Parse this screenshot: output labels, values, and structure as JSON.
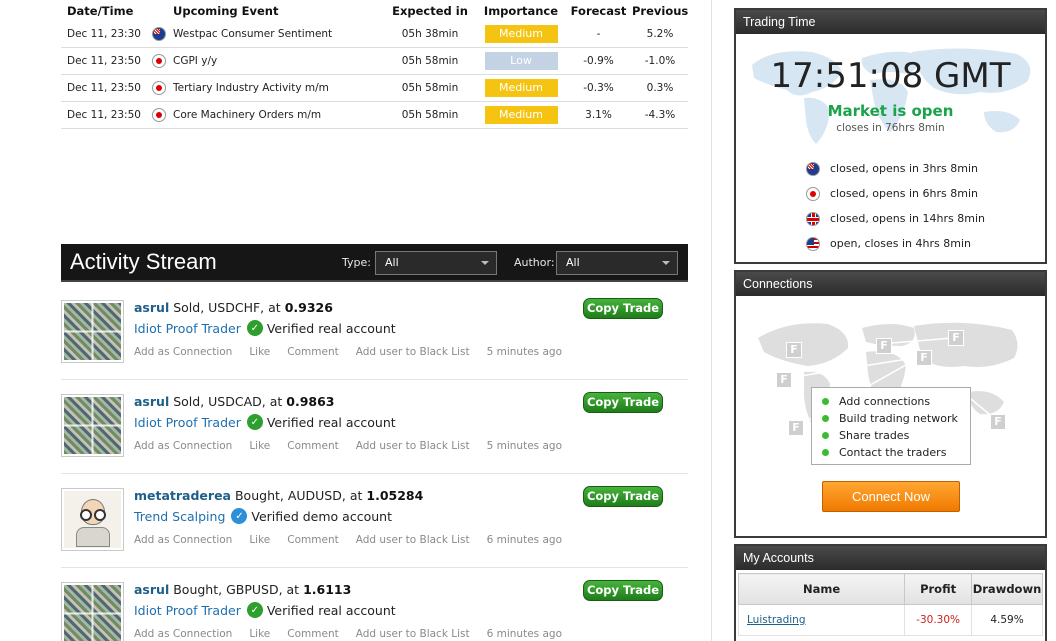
{
  "calendar": {
    "headers": {
      "date": "Date/Time",
      "event": "Upcoming Event",
      "expected": "Expected in",
      "importance": "Importance",
      "forecast": "Forecast",
      "previous": "Previous"
    },
    "rows": [
      {
        "date": "Dec 11, 23:30",
        "flag": "flag-au-icon",
        "event": "Westpac Consumer Sentiment",
        "expected": "05h 38min",
        "importance": "Medium",
        "forecast": "-",
        "previous": "5.2%"
      },
      {
        "date": "Dec 11, 23:50",
        "flag": "flag-jp-icon",
        "event": "CGPI y/y",
        "expected": "05h 58min",
        "importance": "Low",
        "forecast": "-0.9%",
        "previous": "-1.0%"
      },
      {
        "date": "Dec 11, 23:50",
        "flag": "flag-jp-icon",
        "event": "Tertiary Industry Activity m/m",
        "expected": "05h 58min",
        "importance": "Medium",
        "forecast": "-0.3%",
        "previous": "0.3%"
      },
      {
        "date": "Dec 11, 23:50",
        "flag": "flag-jp-icon",
        "event": "Core Machinery Orders m/m",
        "expected": "05h 58min",
        "importance": "Medium",
        "forecast": "3.1%",
        "previous": "-4.3%"
      }
    ]
  },
  "activity": {
    "title": "Activity Stream",
    "type_label": "Type:",
    "type_value": "All",
    "author_label": "Author:",
    "author_value": "All",
    "copy_label": "Copy Trade",
    "actions": {
      "add": "Add as Connection",
      "like": "Like",
      "comment": "Comment",
      "blacklist": "Add user to Black List"
    },
    "posts": [
      {
        "user": "asrul",
        "action": "Sold, USDCHF, at",
        "price": "0.9326",
        "group": "Idiot Proof Trader",
        "verified": "Verified real account",
        "time": "5 minutes ago",
        "avatar": "collage"
      },
      {
        "user": "asrul",
        "action": "Sold, USDCAD, at",
        "price": "0.9863",
        "group": "Idiot Proof Trader",
        "verified": "Verified real account",
        "time": "5 minutes ago",
        "avatar": "collage"
      },
      {
        "user": "metatraderea",
        "action": "Bought, AUDUSD, at",
        "price": "1.05284",
        "group": "Trend Scalping",
        "verified": "Verified demo account",
        "time": "6 minutes ago",
        "avatar": "professor"
      },
      {
        "user": "asrul",
        "action": "Bought, GBPUSD, at",
        "price": "1.6113",
        "group": "Idiot Proof Trader",
        "verified": "Verified real account",
        "time": "6 minutes ago",
        "avatar": "collage"
      }
    ]
  },
  "trading_time": {
    "title": "Trading Time",
    "clock": "17:51:08 GMT",
    "status": "Market is open",
    "closes": "closes in 76hrs 8min",
    "markets": [
      {
        "flag": "flag-au-icon",
        "text": "closed, opens in 3hrs 8min"
      },
      {
        "flag": "flag-jp-icon",
        "text": "closed, opens in 6hrs 8min"
      },
      {
        "flag": "flag-uk-icon",
        "text": "closed, opens in 14hrs 8min"
      },
      {
        "flag": "flag-us-icon",
        "text": "open, closes in 4hrs 8min"
      }
    ]
  },
  "connections": {
    "title": "Connections",
    "badge_letter": "F",
    "items": [
      "Add connections",
      "Build trading network",
      "Share trades",
      "Contact the traders"
    ],
    "button": "Connect Now"
  },
  "accounts": {
    "title": "My Accounts",
    "headers": {
      "name": "Name",
      "profit": "Profit",
      "drawdown": "Drawdown"
    },
    "rows": [
      {
        "name": "Luistrading",
        "profit": "-30.30%",
        "drawdown": "4.59%"
      }
    ]
  }
}
